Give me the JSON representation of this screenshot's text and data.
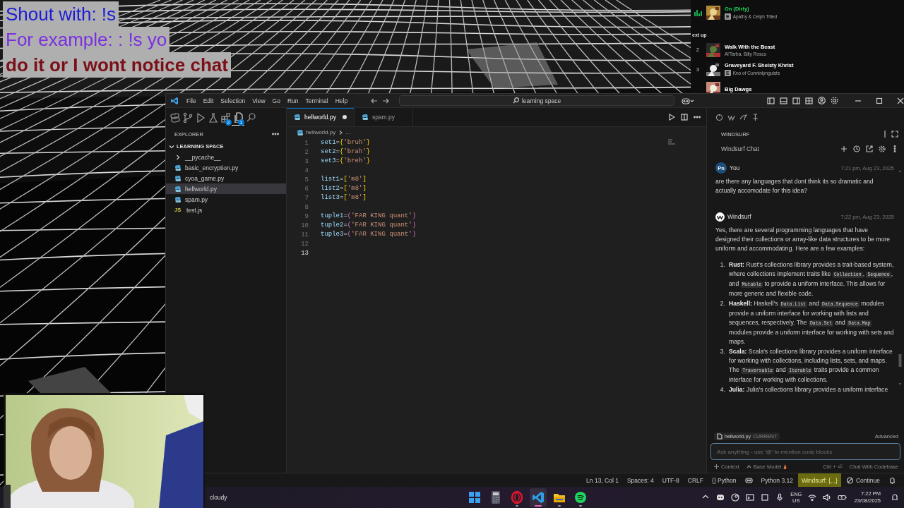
{
  "stream_overlay": {
    "lines": [
      {
        "text": "Shout with: !s",
        "color": "#1c1cd8"
      },
      {
        "text": "For example: : !s yo",
        "color": "#7a2fe0"
      },
      {
        "text": "do it or I wont notice chat",
        "color": "#7a1018"
      }
    ]
  },
  "spotify": {
    "now_playing": {
      "title": "On (Dirty)",
      "artist": "Apathy & Celph Titled",
      "badge": "E"
    },
    "queue_heading": "ext up",
    "queue": [
      {
        "number": "2",
        "title": "Walk With the Beast",
        "artist": "Al'Tarba, Billy Rosco"
      },
      {
        "number": "3",
        "title": "Graveyard F. Sheisty Khrist",
        "artist": "Kno of Cunninlynguists",
        "badge": "E"
      },
      {
        "title": "Big Dawgs"
      }
    ]
  },
  "editor_window": {
    "menu": [
      "File",
      "Edit",
      "Selection",
      "View",
      "Go",
      "Run",
      "Terminal",
      "Help"
    ],
    "search": "learning space",
    "activity_bar": [
      {
        "kind": "python",
        "selected": false
      },
      {
        "kind": "source-control",
        "selected": false
      },
      {
        "kind": "run",
        "selected": false
      },
      {
        "kind": "testing",
        "selected": false
      },
      {
        "kind": "extensions",
        "selected": false,
        "badge": "2"
      },
      {
        "kind": "explorer",
        "selected": true,
        "badge": "1"
      },
      {
        "kind": "search",
        "selected": false
      }
    ],
    "explorer": {
      "title": "EXPLORER",
      "folder": "LEARNING SPACE",
      "expanded": true,
      "files": [
        {
          "name": "__pycache__",
          "kind": "folder",
          "selected": false
        },
        {
          "name": "basic_encryption.py",
          "kind": "python",
          "selected": false
        },
        {
          "name": "cyoa_game.py",
          "kind": "python",
          "selected": false
        },
        {
          "name": "hellworld.py",
          "kind": "python",
          "selected": true
        },
        {
          "name": "spam.py",
          "kind": "python",
          "selected": false
        },
        {
          "name": "test.js",
          "kind": "js",
          "icon_text": "JS",
          "selected": false
        }
      ]
    },
    "tabs": [
      {
        "label": "hellworld.py",
        "selected": true,
        "modified": true
      },
      {
        "label": "spam.py",
        "selected": false,
        "modified": false
      }
    ],
    "breadcrumb": [
      "hellworld.py",
      "..."
    ],
    "code_lines": [
      {
        "number": "1",
        "current": false,
        "tokens": [
          {
            "kind": "var",
            "text": "set1"
          },
          {
            "kind": "op",
            "text": "="
          },
          {
            "kind": "bracket",
            "text": "{"
          },
          {
            "kind": "string",
            "text": "'bruh'"
          },
          {
            "kind": "bracket",
            "text": "}"
          }
        ]
      },
      {
        "number": "2",
        "current": false,
        "tokens": [
          {
            "kind": "var",
            "text": "set2"
          },
          {
            "kind": "op",
            "text": "="
          },
          {
            "kind": "bracket",
            "text": "{"
          },
          {
            "kind": "string",
            "text": "'brah'"
          },
          {
            "kind": "bracket",
            "text": "}"
          }
        ]
      },
      {
        "number": "3",
        "current": false,
        "tokens": [
          {
            "kind": "var",
            "text": "set3"
          },
          {
            "kind": "op",
            "text": "="
          },
          {
            "kind": "bracket",
            "text": "{"
          },
          {
            "kind": "string",
            "text": "'breh'"
          },
          {
            "kind": "bracket",
            "text": "}"
          }
        ]
      },
      {
        "number": "4",
        "current": false
      },
      {
        "number": "5",
        "current": false,
        "tokens": [
          {
            "kind": "var",
            "text": "list1"
          },
          {
            "kind": "op",
            "text": "="
          },
          {
            "kind": "bracket",
            "text": "["
          },
          {
            "kind": "string",
            "text": "'m8'"
          },
          {
            "kind": "bracket",
            "text": "]"
          }
        ]
      },
      {
        "number": "6",
        "current": false,
        "tokens": [
          {
            "kind": "var",
            "text": "list2"
          },
          {
            "kind": "op",
            "text": "="
          },
          {
            "kind": "bracket",
            "text": "["
          },
          {
            "kind": "string",
            "text": "'m8'"
          },
          {
            "kind": "bracket",
            "text": "]"
          }
        ]
      },
      {
        "number": "7",
        "current": false,
        "tokens": [
          {
            "kind": "var",
            "text": "list3"
          },
          {
            "kind": "op",
            "text": "="
          },
          {
            "kind": "bracket",
            "text": "["
          },
          {
            "kind": "string",
            "text": "'m8'"
          },
          {
            "kind": "bracket",
            "text": "]"
          }
        ]
      },
      {
        "number": "8",
        "current": false
      },
      {
        "number": "9",
        "current": false,
        "tokens": [
          {
            "kind": "var",
            "text": "tuple1"
          },
          {
            "kind": "op",
            "text": "="
          },
          {
            "kind": "paren",
            "text": "("
          },
          {
            "kind": "string",
            "text": "'FAR KING quant'"
          },
          {
            "kind": "paren",
            "text": ")"
          }
        ]
      },
      {
        "number": "10",
        "current": false,
        "tokens": [
          {
            "kind": "var",
            "text": "tuple2"
          },
          {
            "kind": "op",
            "text": "="
          },
          {
            "kind": "paren",
            "text": "("
          },
          {
            "kind": "string",
            "text": "'FAR KING quant'"
          },
          {
            "kind": "paren",
            "text": ")"
          }
        ]
      },
      {
        "number": "11",
        "current": false,
        "tokens": [
          {
            "kind": "var",
            "text": "tuple3"
          },
          {
            "kind": "op",
            "text": "="
          },
          {
            "kind": "paren",
            "text": "("
          },
          {
            "kind": "string",
            "text": "'FAR KING quant'"
          },
          {
            "kind": "paren",
            "text": ")"
          }
        ]
      },
      {
        "number": "12",
        "current": false
      },
      {
        "number": "13",
        "current": true
      }
    ],
    "chat": {
      "panel_title": "WINDSURF",
      "title": "Windsurf Chat",
      "messages": [
        {
          "kind": "user",
          "avatar": "Pn",
          "author": "You",
          "time": "7:21 pm, Aug 23, 2025",
          "text": "are there any languages that dont think its so dramatic and actually accomodate for this idea?"
        },
        {
          "kind": "assistant",
          "author": "Windsurf",
          "time": "7:22 pm, Aug 23, 2025",
          "text": "Yes, there are several programming languages that have designed their collections or array-like data structures to be more uniform and accommodating. Here are a few examples:",
          "list": [
            {
              "number": "1.",
              "segments": [
                {
                  "kind": "bold",
                  "text": "Rust:"
                },
                {
                  "kind": "text",
                  "text": " Rust's collections library provides a trait-based system, where collections implement traits like "
                },
                {
                  "kind": "code",
                  "text": "Collection"
                },
                {
                  "kind": "text",
                  "text": ", "
                },
                {
                  "kind": "code",
                  "text": "Sequence"
                },
                {
                  "kind": "text",
                  "text": ", and "
                },
                {
                  "kind": "code",
                  "text": "Mutable"
                },
                {
                  "kind": "text",
                  "text": " to provide a uniform interface. This allows for more generic and flexible code."
                }
              ]
            },
            {
              "number": "2.",
              "segments": [
                {
                  "kind": "bold",
                  "text": "Haskell:"
                },
                {
                  "kind": "text",
                  "text": " Haskell's "
                },
                {
                  "kind": "code",
                  "text": "Data.List"
                },
                {
                  "kind": "text",
                  "text": " and "
                },
                {
                  "kind": "code",
                  "text": "Data.Sequence"
                },
                {
                  "kind": "text",
                  "text": " modules provide a uniform interface for working with lists and sequences, respectively. The "
                },
                {
                  "kind": "code",
                  "text": "Data.Set"
                },
                {
                  "kind": "text",
                  "text": " and "
                },
                {
                  "kind": "code",
                  "text": "Data.Map"
                },
                {
                  "kind": "text",
                  "text": " modules provide a uniform interface for working with sets and maps."
                }
              ]
            },
            {
              "number": "3.",
              "segments": [
                {
                  "kind": "bold",
                  "text": "Scala:"
                },
                {
                  "kind": "text",
                  "text": " Scala's collections library provides a uniform interface for working with collections, including lists, sets, and maps. The "
                },
                {
                  "kind": "code",
                  "text": "Traversable"
                },
                {
                  "kind": "text",
                  "text": " and "
                },
                {
                  "kind": "code",
                  "text": "Iterable"
                },
                {
                  "kind": "text",
                  "text": " traits provide a common interface for working with collections."
                }
              ]
            },
            {
              "number": "4.",
              "segments": [
                {
                  "kind": "bold",
                  "text": "Julia:"
                },
                {
                  "kind": "text",
                  "text": " Julia's collections library provides a uniform interface"
                }
              ]
            }
          ]
        }
      ],
      "context_file": "hellworld.py",
      "context_tag": "CURRENT",
      "mode": "Advanced",
      "input_placeholder": "Ask anything - use '@' to mention code blocks",
      "footer": {
        "context": "Context",
        "model": "Base Model",
        "shortcut": "Ctrl + ⏎",
        "codebase": "Chat With Codebase"
      }
    },
    "status_bar": [
      {
        "kind": "text",
        "text": "Ln 13, Col 1",
        "highlighted": false
      },
      {
        "kind": "text",
        "text": "Spaces: 4",
        "highlighted": false
      },
      {
        "kind": "text",
        "text": "UTF-8",
        "highlighted": false
      },
      {
        "kind": "text",
        "text": "CRLF",
        "highlighted": false
      },
      {
        "kind": "text",
        "text": "{} Python",
        "highlighted": false
      },
      {
        "kind": "copilot",
        "highlighted": false
      },
      {
        "kind": "text",
        "text": "Python 3.12",
        "highlighted": false
      },
      {
        "kind": "text",
        "text": "Windsurf: {...}",
        "highlighted": true
      },
      {
        "kind": "no-entry",
        "text": "Continue",
        "highlighted": false
      },
      {
        "kind": "bell",
        "highlighted": false
      }
    ]
  },
  "taskbar": {
    "weather": "cloudy",
    "apps": [
      {
        "kind": "start",
        "running": false,
        "active": false
      },
      {
        "kind": "calculator",
        "running": false,
        "active": false
      },
      {
        "kind": "opera",
        "running": true,
        "active": false
      },
      {
        "kind": "vscode",
        "running": true,
        "active": true
      },
      {
        "kind": "files",
        "running": true,
        "active": false
      },
      {
        "kind": "spotify",
        "running": true,
        "active": false
      }
    ],
    "language": "ENG",
    "region": "US",
    "time": "7:22 PM",
    "date": "23/08/2025"
  }
}
